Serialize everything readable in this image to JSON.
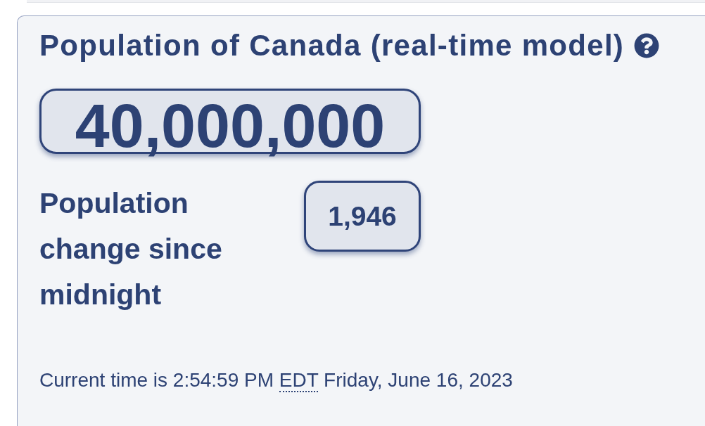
{
  "title": "Population of Canada (real-time model)",
  "population": {
    "value": "40,000,000"
  },
  "change": {
    "label": "Population change since midnight",
    "value": "1,946"
  },
  "current_time": {
    "prefix": "Current time is 2:54:59 PM",
    "timezone": "EDT",
    "date": "Friday, June 16, 2023"
  }
}
